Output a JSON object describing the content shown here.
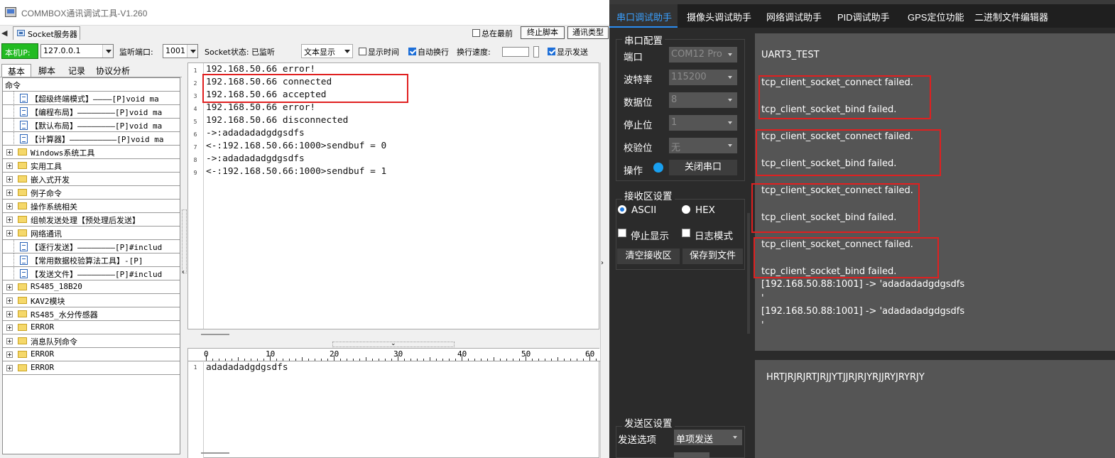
{
  "left_window": {
    "title": "COMMBOX通讯调试工具-V1.260",
    "tab_label": "Socket服务器",
    "always_on_top_label": "总在最前",
    "stop_script_label": "终止脚本",
    "comm_type_label": "通讯类型",
    "local_ip_label": "本机IP:",
    "local_ip_value": "127.0.0.1",
    "listen_port_label": "监听端口:",
    "listen_port_value": "1001",
    "socket_status": "Socket状态: 已监听",
    "display_mode": "文本显示",
    "show_time_label": "显示时间",
    "auto_wrap_label": "自动换行",
    "wrap_speed_label": "换行速度:",
    "show_send_label": "显示发送",
    "side_tabs": [
      "基本",
      "脚本",
      "记录",
      "协议分析"
    ],
    "tree": [
      {
        "label": "命令",
        "kind": "root"
      },
      {
        "label": "【超级终端模式】————[P]void ma",
        "kind": "doc"
      },
      {
        "label": "【编程布局】————————[P]void ma",
        "kind": "doc"
      },
      {
        "label": "【默认布局】————————[P]void ma",
        "kind": "doc"
      },
      {
        "label": "【计算器】——————————[P]void ma",
        "kind": "doc"
      },
      {
        "label": "Windows系统工具",
        "kind": "folder"
      },
      {
        "label": "实用工具",
        "kind": "folder"
      },
      {
        "label": "嵌入式开发",
        "kind": "folder"
      },
      {
        "label": "例子命令",
        "kind": "folder"
      },
      {
        "label": "操作系统相关",
        "kind": "folder"
      },
      {
        "label": "组帧发送处理【预处理后发送】",
        "kind": "folder"
      },
      {
        "label": "网络通讯",
        "kind": "folder"
      },
      {
        "label": "【逐行发送】————————[P]#includ",
        "kind": "doc"
      },
      {
        "label": "【常用数据校验算法工具】-[P]",
        "kind": "doc"
      },
      {
        "label": "【发送文件】————————[P]#includ",
        "kind": "doc"
      },
      {
        "label": "RS485_18B20",
        "kind": "folder"
      },
      {
        "label": "KAV2模块",
        "kind": "folder"
      },
      {
        "label": "RS485_水分传感器",
        "kind": "folder"
      },
      {
        "label": "ERROR",
        "kind": "folder"
      },
      {
        "label": "消息队列命令",
        "kind": "folder"
      },
      {
        "label": "ERROR",
        "kind": "folder"
      },
      {
        "label": "ERROR",
        "kind": "folder"
      }
    ],
    "receive_lines": [
      "192.168.50.66 error!",
      "192.168.50.66 connected",
      "192.168.50.66 accepted",
      "192.168.50.66 error!",
      "192.168.50.66 disconnected",
      "->:adadadadgdgsdfs",
      "<-:192.168.50.66:1000>sendbuf = 0",
      "->:adadadadgdgsdfs",
      "<-:192.168.50.66:1000>sendbuf = 1"
    ],
    "line_numbers": [
      "1",
      "2",
      "3",
      "4",
      "5",
      "6",
      "7",
      "8",
      "9"
    ],
    "ruler_labels": [
      "0",
      "10",
      "20",
      "30",
      "40",
      "50",
      "60"
    ],
    "send_line_number": "1",
    "send_text": "adadadadgdgsdfs"
  },
  "right_window": {
    "tabs": [
      "串口调试助手",
      "摄像头调试助手",
      "网络调试助手",
      "PID调试助手",
      "GPS定位功能",
      "二进制文件编辑器"
    ],
    "serial_config_title": "串口配置",
    "port_label": "端口",
    "port_value": "COM12 Pro",
    "baud_label": "波特率",
    "baud_value": "115200",
    "databits_label": "数据位",
    "databits_value": "8",
    "stopbits_label": "停止位",
    "stopbits_value": "1",
    "parity_label": "校验位",
    "parity_value": "无",
    "operate_label": "操作",
    "close_port_label": "关闭串口",
    "recv_settings_title": "接收区设置",
    "ascii_label": "ASCII",
    "hex_label": "HEX",
    "stop_display_label": "停止显示",
    "log_mode_label": "日志模式",
    "clear_recv_label": "清空接收区",
    "save_file_label": "保存到文件",
    "send_settings_title": "发送区设置",
    "send_option_label": "发送选项",
    "send_option_value": "单项发送",
    "recv_lines": [
      "UART3_TEST",
      "tcp_client_socket_connect failed.",
      "tcp_client_socket_bind failed.",
      "tcp_client_socket_connect failed.",
      "tcp_client_socket_bind failed.",
      "tcp_client_socket_connect failed.",
      "tcp_client_socket_bind failed.",
      "tcp_client_socket_connect failed.",
      "tcp_client_socket_bind failed.",
      "[192.168.50.88:1001] -> 'adadadadgdgsdfs",
      "'",
      "[192.168.50.88:1001] -> 'adadadadgdgsdfs",
      "'"
    ],
    "send_text": "HRTJRJRJRTJRJJYTJJRJRJYRJJRYJRYRJY"
  },
  "colors": {
    "accent": "#2a8cf0",
    "highlight": "#e02020",
    "green_label": "#22bb22"
  }
}
